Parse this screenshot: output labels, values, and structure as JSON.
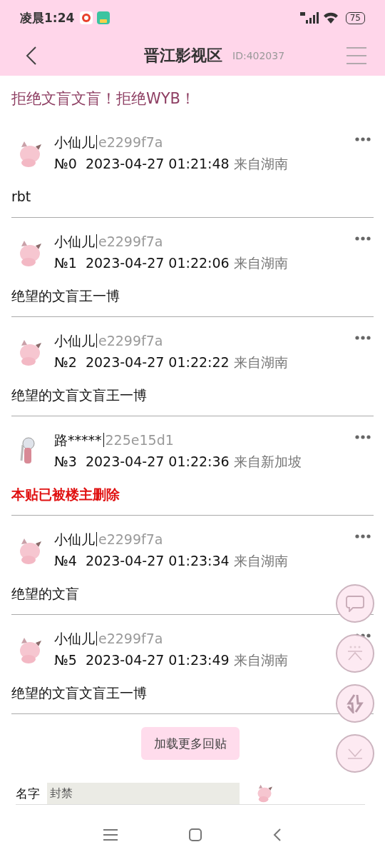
{
  "status_bar": {
    "time": "凌晨1:24",
    "battery": "75"
  },
  "header": {
    "title": "晋江影视区",
    "id": "ID:402037"
  },
  "notice": "拒绝文盲文盲！拒绝WYB！",
  "posts": [
    {
      "avatar": {
        "kind": "pink"
      },
      "name": "小仙儿",
      "uid": "e2299f7a",
      "floor": "№0",
      "time": "2023-04-27 01:21:48",
      "location": "来自湖南",
      "kind": "normal",
      "body": "rbt"
    },
    {
      "avatar": {
        "kind": "pink"
      },
      "name": "小仙儿",
      "uid": "e2299f7a",
      "floor": "№1",
      "time": "2023-04-27 01:22:06",
      "location": "来自湖南",
      "kind": "normal",
      "body": "绝望的文盲王一博"
    },
    {
      "avatar": {
        "kind": "pink"
      },
      "name": "小仙儿",
      "uid": "e2299f7a",
      "floor": "№2",
      "time": "2023-04-27 01:22:22",
      "location": "来自湖南",
      "kind": "normal",
      "body": "绝望的文盲文盲王一博"
    },
    {
      "avatar": {
        "kind": "figure"
      },
      "name": "路*****",
      "uid": "225e15d1",
      "floor": "№3",
      "time": "2023-04-27 01:22:36",
      "location": "来自新加坡",
      "kind": "deleted",
      "body": "本贴已被楼主删除"
    },
    {
      "avatar": {
        "kind": "pink"
      },
      "name": "小仙儿",
      "uid": "e2299f7a",
      "floor": "№4",
      "time": "2023-04-27 01:23:34",
      "location": "来自湖南",
      "kind": "normal",
      "body": "绝望的文盲"
    },
    {
      "avatar": {
        "kind": "pink"
      },
      "name": "小仙儿",
      "uid": "e2299f7a",
      "floor": "№5",
      "time": "2023-04-27 01:23:49",
      "location": "来自湖南",
      "kind": "normal",
      "body": "绝望的文盲文盲王一博"
    }
  ],
  "load_more": "加载更多回贴",
  "reply_form": {
    "name_label": "名字",
    "name_value": "封禁"
  }
}
